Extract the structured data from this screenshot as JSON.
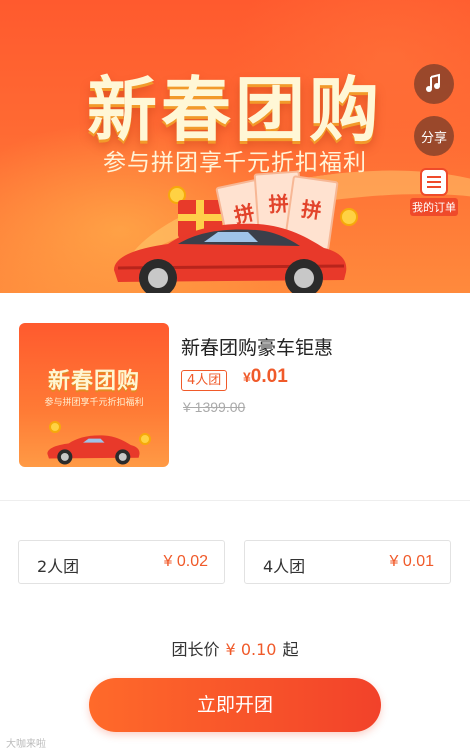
{
  "banner": {
    "title": "新春团购",
    "subtitle": "参与拼团享千元折扣福利",
    "coupon_text": "拼"
  },
  "floating": {
    "share_label": "分享",
    "order_label": "我的订单"
  },
  "product": {
    "thumb_title": "新春团购",
    "thumb_subtitle": "参与拼团享千元折扣福利",
    "title": "新春团购豪车钜惠",
    "group_tag": "4人团",
    "currency": "¥",
    "price": "0.01",
    "original_price": "¥ 1399.00"
  },
  "options": [
    {
      "name": "2人团",
      "price": "¥ 0.02"
    },
    {
      "name": "4人团",
      "price": "¥ 0.01"
    }
  ],
  "leader": {
    "label": "团长价",
    "price": "¥ 0.10",
    "suffix": "起"
  },
  "cta": {
    "label": "立即开团"
  },
  "watermark": "大咖来啦",
  "colors": {
    "accent": "#f05a2a",
    "banner_top": "#ff5a2e",
    "banner_bottom": "#ff8a3c"
  }
}
